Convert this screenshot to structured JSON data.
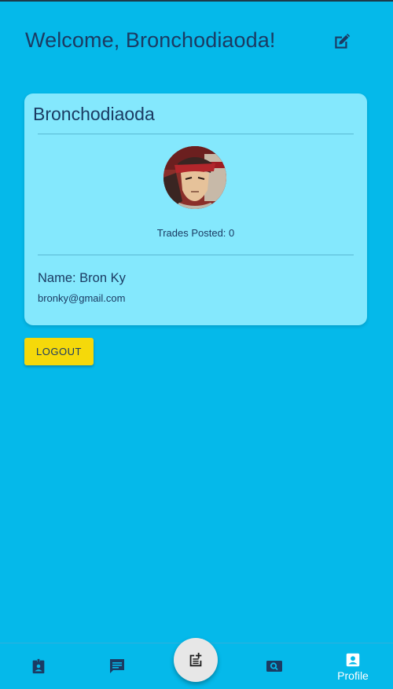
{
  "header": {
    "welcome": "Welcome, Bronchodiaoda!",
    "edit_icon": "edit-icon"
  },
  "profile_card": {
    "username": "Bronchodiaoda",
    "trades_posted": "Trades Posted: 0",
    "name": "Name: Bron Ky",
    "email": "bronky@gmail.com"
  },
  "logout_label": "LOGOUT",
  "bottom_nav": {
    "items": [
      {
        "icon": "badge-icon",
        "label": ""
      },
      {
        "icon": "chat-icon",
        "label": ""
      },
      {
        "icon": "post-add-icon",
        "label": ""
      },
      {
        "icon": "search-photo-icon",
        "label": ""
      },
      {
        "icon": "profile-icon",
        "label": "Profile"
      }
    ]
  },
  "colors": {
    "background": "#05b9ea",
    "card": "#84e8fd",
    "text": "#1b3b63",
    "logout": "#f5d90a",
    "fab": "#e7e7e7"
  }
}
